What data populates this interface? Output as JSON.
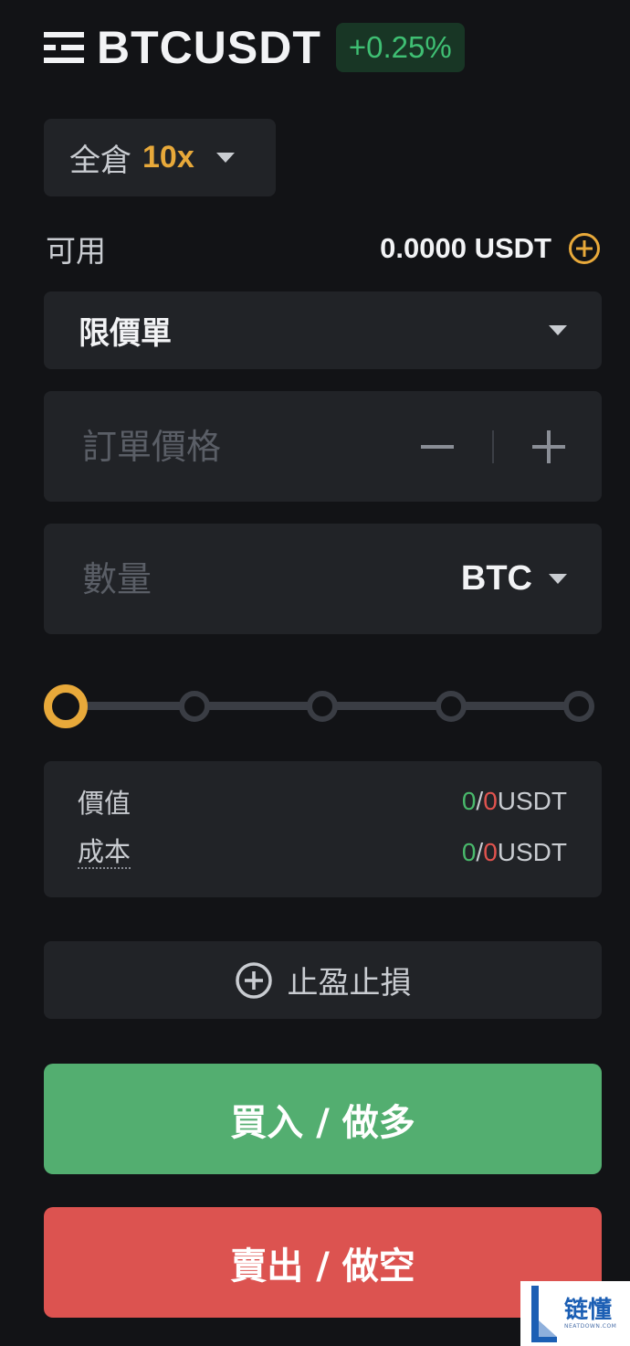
{
  "header": {
    "symbol": "BTCUSDT",
    "change": "+0.25%"
  },
  "margin": {
    "mode": "全倉",
    "leverage": "10x"
  },
  "available": {
    "label": "可用",
    "value": "0.0000 USDT"
  },
  "order_type": {
    "selected": "限價單"
  },
  "price_input": {
    "placeholder": "訂單價格",
    "value": ""
  },
  "quantity_input": {
    "placeholder": "數量",
    "value": "",
    "unit": "BTC"
  },
  "slider": {
    "value_percent": 0,
    "stops": 5
  },
  "summary": {
    "value": {
      "label": "價值",
      "long": "0",
      "sep": "/",
      "short": "0",
      "unit": "USDT"
    },
    "cost": {
      "label": "成本",
      "long": "0",
      "sep": "/",
      "short": "0",
      "unit": "USDT"
    }
  },
  "tpsl": {
    "label": "止盈止損"
  },
  "actions": {
    "buy": "買入 / 做多",
    "sell": "賣出 / 做空"
  },
  "watermark": {
    "cn": "链懂",
    "en": "NEATDOWN.COM"
  },
  "colors": {
    "background": "#121316",
    "panel": "#212327",
    "accent": "#e8a93a",
    "green": "#53ae70",
    "red": "#dc5350"
  }
}
